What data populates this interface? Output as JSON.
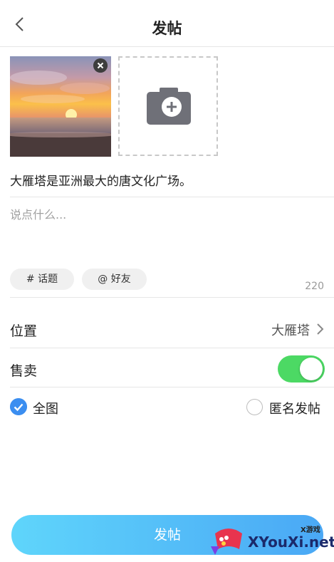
{
  "header": {
    "title": "发帖"
  },
  "media": {
    "photo_icon": "sunset-beach-photo",
    "remove_icon": "close-icon",
    "add_icon": "camera-plus-icon"
  },
  "post": {
    "caption": "大雁塔是亚洲最大的唐文化广场。",
    "placeholder": "说点什么...",
    "char_count": "220"
  },
  "chips": {
    "topic": "# 话题",
    "friend": "@ 好友"
  },
  "location": {
    "label": "位置",
    "value": "大雁塔"
  },
  "sell": {
    "label": "售卖",
    "enabled": true
  },
  "options": {
    "full_image": {
      "label": "全图",
      "checked": true
    },
    "anonymous": {
      "label": "匿名发帖",
      "checked": false
    }
  },
  "submit_label": "发帖",
  "watermark": {
    "small": "X游戏",
    "text": "XYouXi.net"
  },
  "colors": {
    "accent": "#3b8ef0",
    "toggle_on": "#4cd964",
    "button_start": "#5fd5fb",
    "button_end": "#4aa8f5"
  }
}
